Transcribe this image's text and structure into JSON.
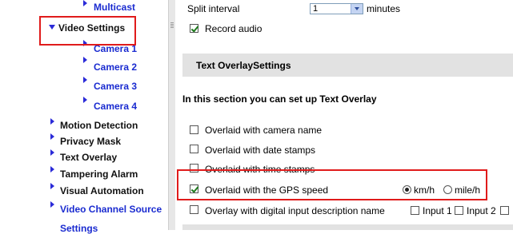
{
  "sidebar": {
    "items": [
      {
        "label": "Multicast"
      },
      {
        "label": "Video Settings"
      },
      {
        "label": "Camera 1"
      },
      {
        "label": "Camera 2"
      },
      {
        "label": "Camera 3"
      },
      {
        "label": "Camera 4"
      },
      {
        "label": "Motion Detection"
      },
      {
        "label": "Privacy Mask"
      },
      {
        "label": "Text Overlay"
      },
      {
        "label": "Tampering Alarm"
      },
      {
        "label": "Visual Automation"
      },
      {
        "label": "Video Channel Source"
      },
      {
        "label": "Settings"
      }
    ]
  },
  "main": {
    "split_interval_label": "Split interval",
    "split_interval_value": "1",
    "split_interval_unit": "minutes",
    "record_audio_label": "Record audio",
    "section_title": "Text OverlaySettings",
    "intro": "In this section you can set up Text Overlay",
    "options": [
      {
        "label": "Overlaid with camera name",
        "checked": false
      },
      {
        "label": "Overlaid with date stamps",
        "checked": false
      },
      {
        "label": "Overlaid with time stamps",
        "checked": false
      },
      {
        "label": "Overlaid with the GPS speed",
        "checked": true
      },
      {
        "label": "Overlay with digital input description name",
        "checked": false
      }
    ],
    "speed_units": [
      "km/h",
      "mile/h"
    ],
    "speed_selected": "km/h",
    "inputs": [
      "Input 1",
      "Input 2"
    ]
  },
  "colors": {
    "highlight": "#e01b1b",
    "link": "#1a2bd0",
    "section_bg": "#e2e2e2"
  }
}
